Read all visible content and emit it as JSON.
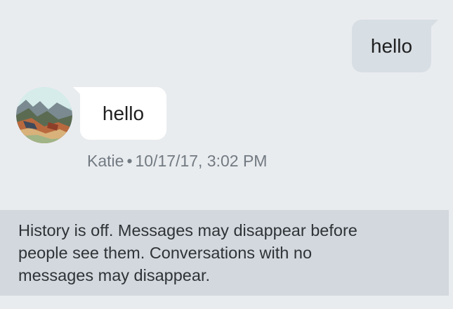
{
  "conversation": {
    "outgoing_messages": [
      {
        "text": "hello"
      }
    ],
    "incoming_messages": [
      {
        "text": "hello",
        "sender": "Katie",
        "timestamp": "10/17/17, 3:02 PM"
      }
    ],
    "meta_separator": "•"
  },
  "history_notice": {
    "lines": [
      "History is off. Messages may disappear before",
      "people see them. Conversations with no",
      "messages may disappear."
    ]
  },
  "avatar": {
    "icon": "landscape-avatar-icon"
  }
}
